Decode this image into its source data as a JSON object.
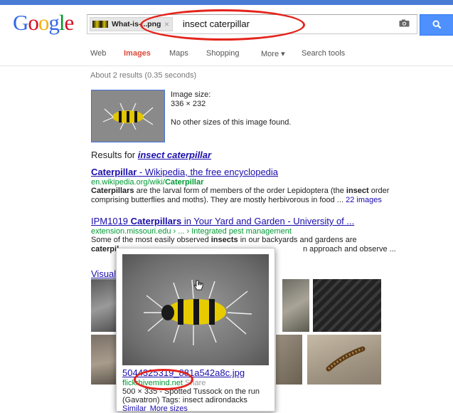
{
  "logo": {
    "letters": [
      "G",
      "o",
      "o",
      "g",
      "l",
      "e"
    ],
    "colors": [
      "#3369e8",
      "#d50f25",
      "#eeb211",
      "#3369e8",
      "#009925",
      "#d50f25"
    ]
  },
  "search": {
    "chip_label": "What-is-...png",
    "chip_close": "×",
    "query": "insect caterpillar"
  },
  "nav": {
    "items": [
      "Web",
      "Images",
      "Maps",
      "Shopping",
      "More ▾",
      "Search tools"
    ],
    "active": "Images"
  },
  "stats": "About 2 results (0.35 seconds)",
  "image_info": {
    "size_label": "Image size:",
    "size_value": "336 × 232",
    "no_other": "No other sizes of this image found."
  },
  "results_for": {
    "prefix": "Results for ",
    "query": "insect caterpillar"
  },
  "results": [
    {
      "title_bold": "Caterpillar",
      "title_rest": " - Wikipedia, the free encyclopedia",
      "url_plain": "en.wikipedia.org/wiki/",
      "url_bold": "Caterpillar",
      "line1_bold": "Caterpillars",
      "line1_a": " are the larval form of members of the order Lepidoptera (the ",
      "line1_bold2": "insect",
      "line1_b": " order",
      "line2": "comprising butterflies and moths). They are mostly herbivorous in food ... ",
      "line2_link": "22 images"
    },
    {
      "title_a": "IPM1019 ",
      "title_bold": "Caterpillars",
      "title_rest": " in Your Yard and Garden - University of ...",
      "url": "extension.missouri.edu › ... › Integrated pest management",
      "line1_a": "Some of the most easily observed ",
      "line1_bold": "insects",
      "line1_b": " in our backyards and gardens are",
      "line2_bold": "caterpil",
      "line2_rest": "n approach and observe ..."
    }
  ],
  "visual_label": "Visuall",
  "popup": {
    "filename": "5044325319_881a542a8c.jpg",
    "site": "flickrhivemind.net",
    "share": "Share",
    "desc1": "500 × 335 - Spotted Tussock on the run",
    "desc2": "(Gavatron) Tags: insect adirondacks",
    "similar": "Similar",
    "more_sizes": "More sizes"
  }
}
